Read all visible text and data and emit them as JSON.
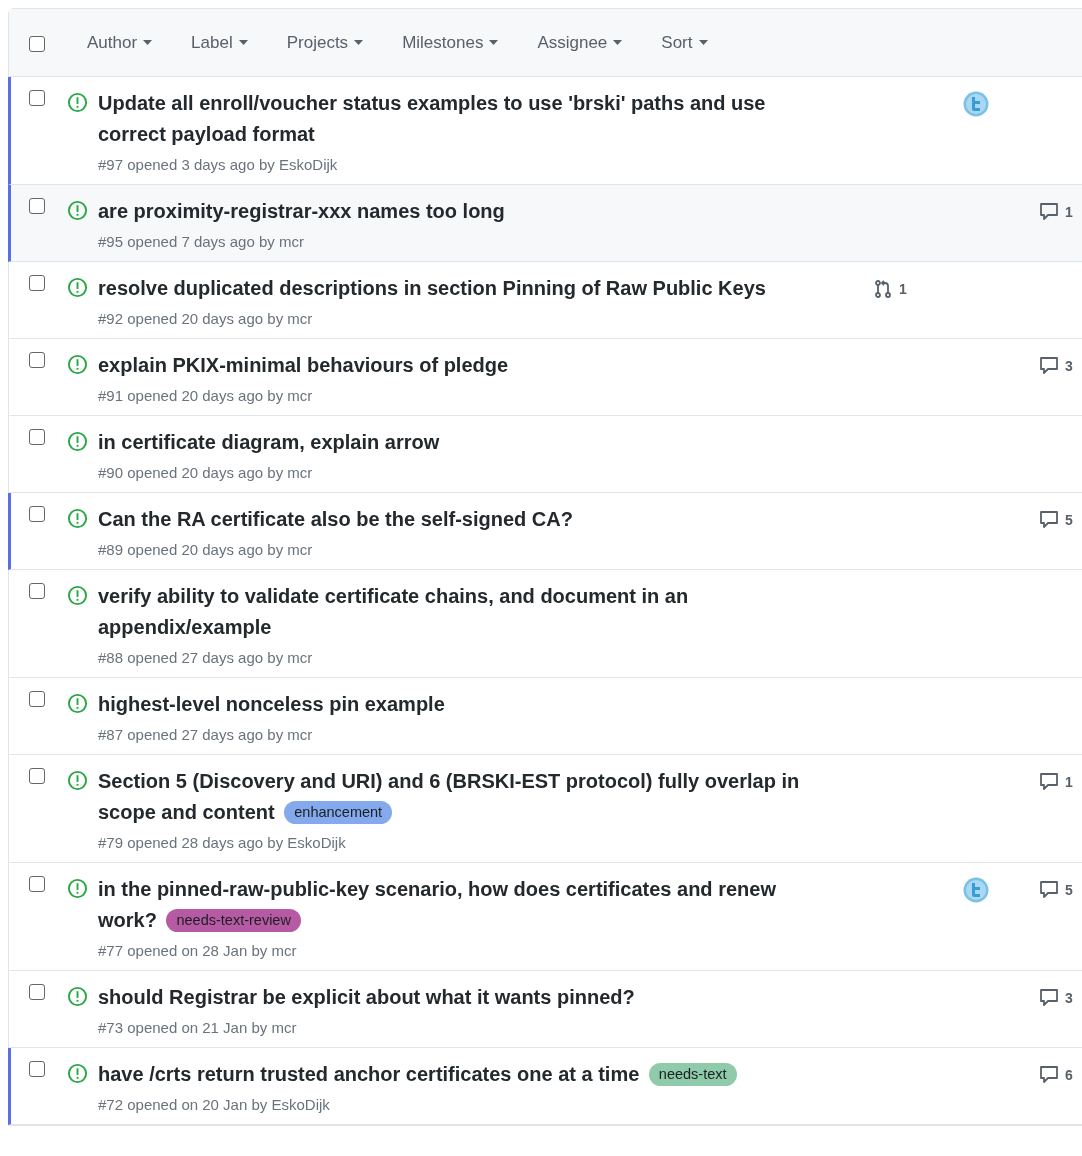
{
  "header": {
    "select_all": {
      "checked": false
    },
    "filters": [
      "Author",
      "Label",
      "Projects",
      "Milestones",
      "Assignee",
      "Sort"
    ]
  },
  "issues": [
    {
      "title": "Update all enroll/voucher status examples to use 'brski' paths and use correct payload format",
      "meta": "#97 opened 3 days ago by EskoDijk",
      "checked": false,
      "unread": true,
      "highlighted": false,
      "assigned": true
    },
    {
      "title": "are proximity-registrar-xxx names too long",
      "meta": "#95 opened 7 days ago by mcr",
      "checked": false,
      "unread": true,
      "highlighted": true,
      "assigned": false,
      "comments": "1"
    },
    {
      "title": "resolve duplicated descriptions in section Pinning of Raw Public Keys",
      "meta": "#92 opened 20 days ago by mcr",
      "checked": false,
      "unread": false,
      "highlighted": false,
      "assigned": false,
      "pull_requests": "1"
    },
    {
      "title": "explain PKIX-minimal behaviours of pledge",
      "meta": "#91 opened 20 days ago by mcr",
      "checked": false,
      "unread": false,
      "highlighted": false,
      "assigned": false,
      "comments": "3"
    },
    {
      "title": "in certificate diagram, explain arrow",
      "meta": "#90 opened 20 days ago by mcr",
      "checked": false,
      "unread": false,
      "highlighted": false,
      "assigned": false
    },
    {
      "title": "Can the RA certificate also be the self-signed CA?",
      "meta": "#89 opened 20 days ago by mcr",
      "checked": false,
      "unread": true,
      "highlighted": false,
      "assigned": false,
      "comments": "5"
    },
    {
      "title": "verify ability to validate certificate chains, and document in an appendix/example",
      "meta": "#88 opened 27 days ago by mcr",
      "checked": false,
      "unread": false,
      "highlighted": false,
      "assigned": false
    },
    {
      "title": "highest-level nonceless pin example",
      "meta": "#87 opened 27 days ago by mcr",
      "checked": false,
      "unread": false,
      "highlighted": false,
      "assigned": false
    },
    {
      "title": "Section 5 (Discovery and URI) and 6 (BRSKI-EST protocol) fully overlap in scope and content",
      "labels": [
        {
          "name": "enhancement",
          "color": "#84a9ec"
        }
      ],
      "meta": "#79 opened 28 days ago by EskoDijk",
      "checked": false,
      "unread": false,
      "highlighted": false,
      "assigned": false,
      "comments": "1"
    },
    {
      "title": "in the pinned-raw-public-key scenario, how does certificates and renew work?",
      "labels": [
        {
          "name": "needs-text-review",
          "color": "#b65aa3"
        }
      ],
      "meta": "#77 opened on 28 Jan by mcr",
      "checked": false,
      "unread": false,
      "highlighted": false,
      "assigned": true,
      "comments": "5"
    },
    {
      "title": "should Registrar be explicit about what it wants pinned?",
      "meta": "#73 opened on 21 Jan by mcr",
      "checked": false,
      "unread": false,
      "highlighted": false,
      "assigned": false,
      "comments": "3"
    },
    {
      "title": "have /crts return trusted anchor certificates one at a time",
      "labels": [
        {
          "name": "needs-text",
          "color": "#8fcaaa"
        }
      ],
      "meta": "#72 opened on 20 Jan by EskoDijk",
      "checked": false,
      "unread": true,
      "highlighted": false,
      "assigned": false,
      "comments": "6"
    }
  ]
}
